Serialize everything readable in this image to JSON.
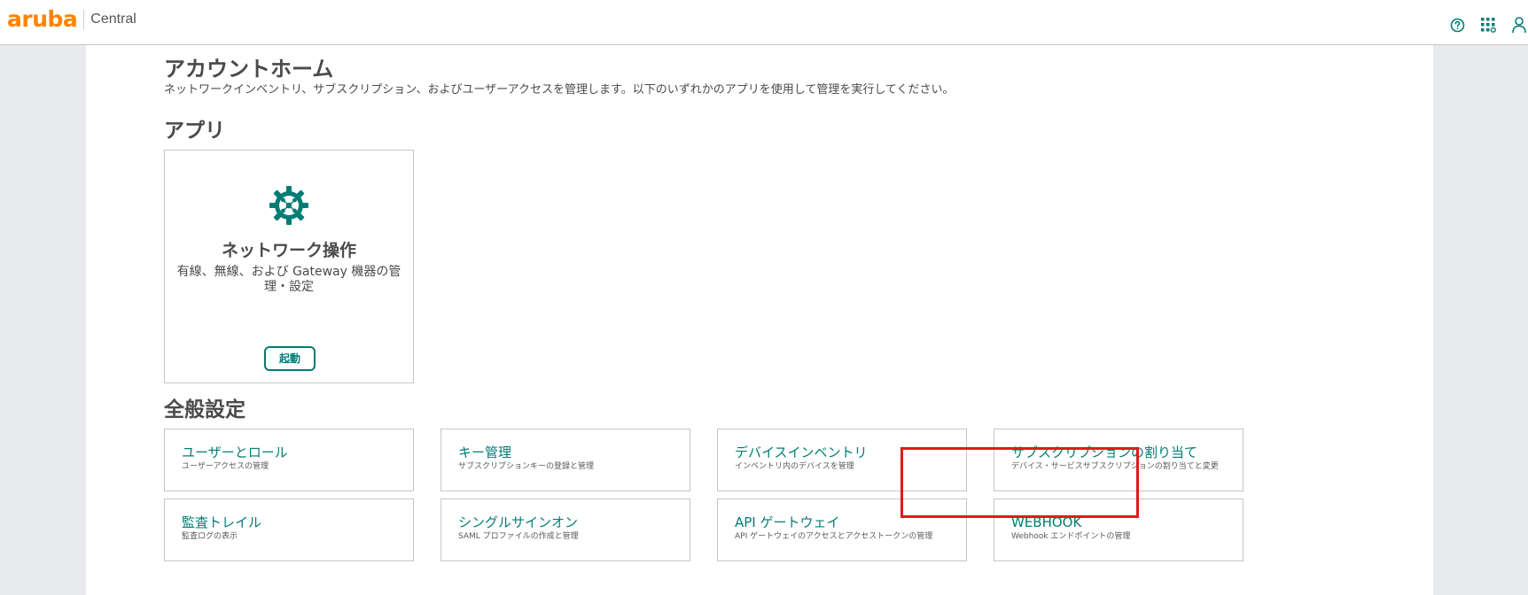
{
  "header": {
    "logo_text": "aruba",
    "product_name": "Central",
    "icons": [
      "help-icon",
      "apps-grid-icon",
      "user-icon"
    ],
    "accent_color": "#ff8300",
    "teal_color": "#017d74"
  },
  "main": {
    "title": "アカウントホーム",
    "description": "ネットワークインベントリ、サブスクリプション、およびユーザーアクセスを管理します。以下のいずれかのアプリを使用して管理を実行してください。",
    "apps_heading": "アプリ",
    "app_card": {
      "icon": "network-gear-icon",
      "title": "ネットワーク操作",
      "subtitle": "有線、無線、および Gateway 機器の管理・設定",
      "launch_label": "起動"
    },
    "general_heading": "全般設定",
    "settings": [
      {
        "title": "ユーザーとロール",
        "subtitle": "ユーザーアクセスの管理"
      },
      {
        "title": "キー管理",
        "subtitle": "サブスクリプションキーの登録と管理"
      },
      {
        "title": "デバイスインベントリ",
        "subtitle": "インベントリ内のデバイスを管理"
      },
      {
        "title": "サブスクリプションの割り当て",
        "subtitle": "デバイス・サービスサブスクリプションの割り当てと変更"
      },
      {
        "title": "監査トレイル",
        "subtitle": "監査ログの表示"
      },
      {
        "title": "シングルサインオン",
        "subtitle": "SAML プロファイルの作成と管理"
      },
      {
        "title": "API ゲートウェイ",
        "subtitle": "API ゲートウェイのアクセスとアクセストークンの管理"
      },
      {
        "title": "WEBHOOK",
        "subtitle": "Webhook エンドポイントの管理"
      }
    ],
    "highlight_color": "#e01a1a"
  }
}
